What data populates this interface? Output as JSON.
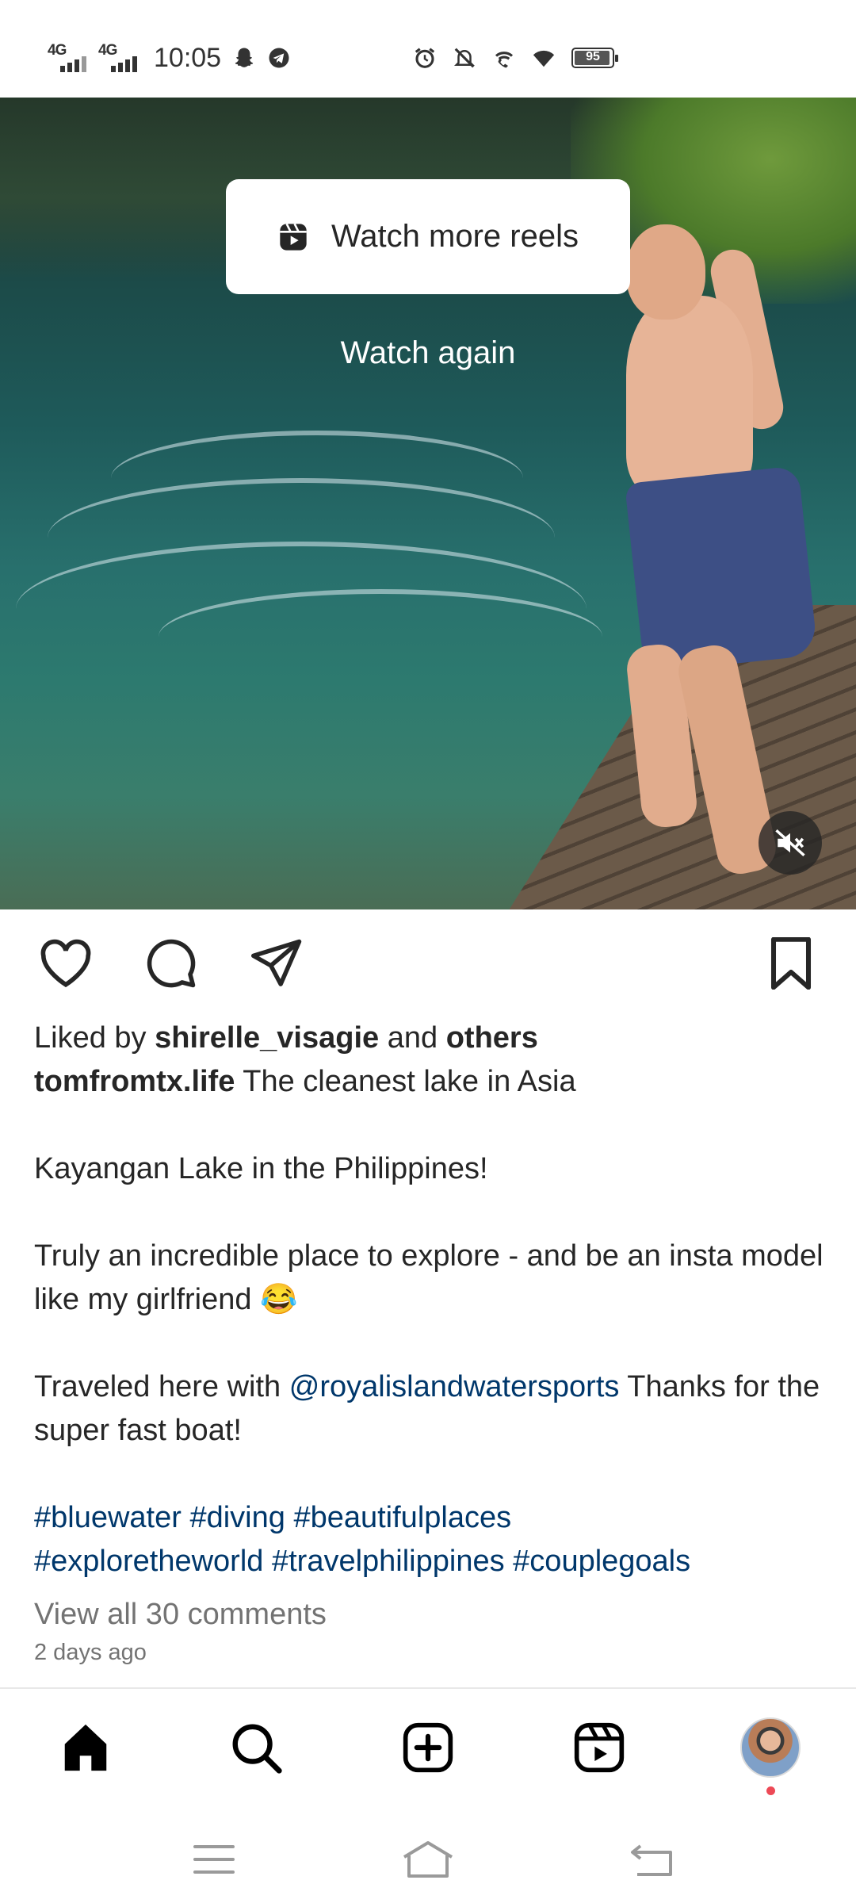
{
  "status_bar": {
    "network_1": "4G",
    "network_2": "4G",
    "time": "10:05",
    "battery": "95",
    "battery_level": 0.95,
    "left_icons": [
      "snapchat-icon",
      "telegram-icon"
    ],
    "right_icons": [
      "alarm-icon",
      "silent-mode-icon",
      "wifi-calling-icon",
      "wifi-icon",
      "battery-icon"
    ]
  },
  "video": {
    "watch_more_label": "Watch more reels",
    "watch_again_label": "Watch again",
    "mute_icon": "muted-speaker-icon"
  },
  "post": {
    "liked_by_prefix": "Liked by ",
    "liked_by_user": "shirelle_visagie",
    "liked_by_and": " and ",
    "liked_by_others": "others",
    "author": "tomfromtx.life",
    "caption_line1": " The cleanest lake in Asia",
    "caption_line2": "Kayangan Lake in the Philippines!",
    "caption_line3": "Truly an incredible place to explore - and be an insta model like my girlfriend 😂",
    "caption_line4_prefix": "Traveled here with ",
    "mention": "@royalislandwatersports",
    "caption_line4_suffix": " Thanks for the super fast boat!",
    "hashtags": [
      "#bluewater",
      "#diving",
      "#beautifulplaces",
      "#exploretheworld",
      "#travelphilippines",
      "#couplegoals"
    ],
    "view_comments": "View all 30 comments",
    "time_ago": "2 days ago"
  },
  "bottom_nav": [
    "home-icon",
    "search-icon",
    "create-icon",
    "reels-icon",
    "profile-avatar"
  ],
  "colors": {
    "text": "#262626",
    "link": "#00376b",
    "muted": "#737373",
    "notification": "#ed4956"
  }
}
